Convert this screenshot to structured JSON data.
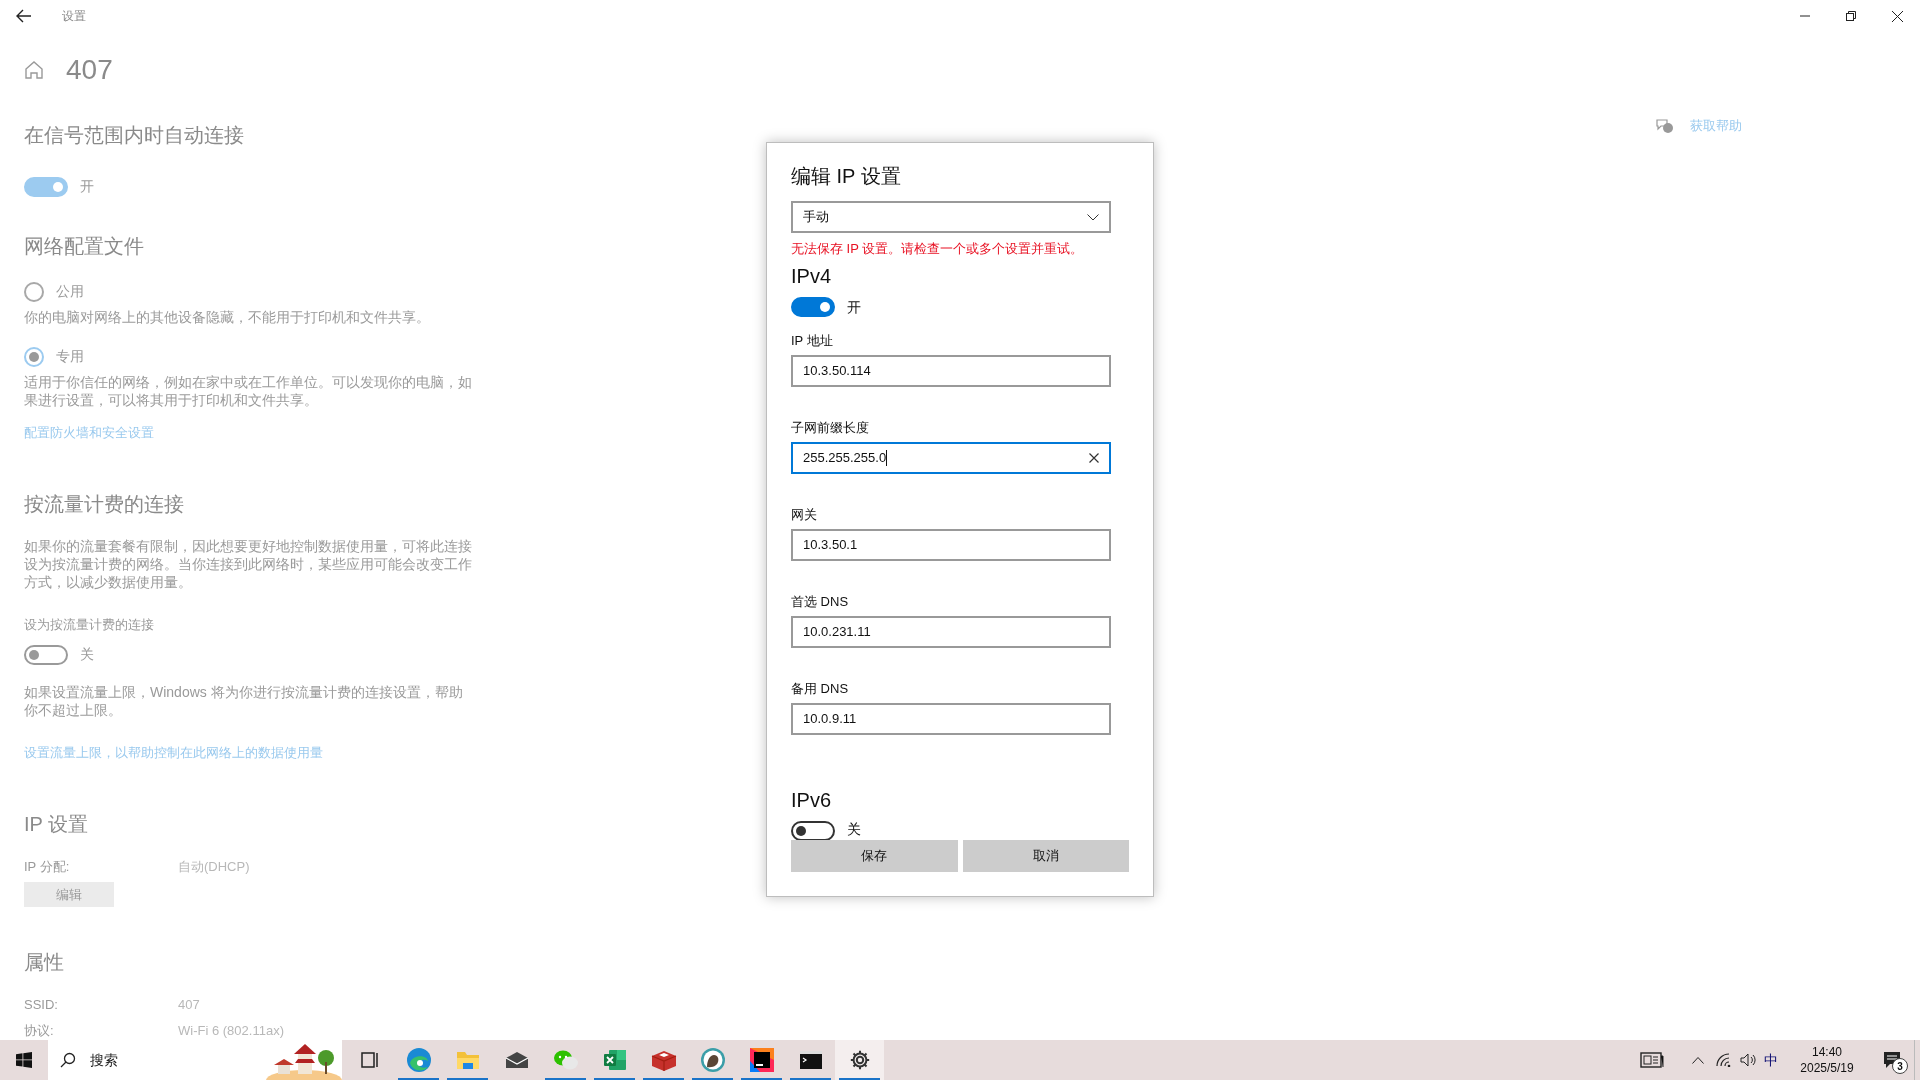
{
  "window": {
    "title": "设置"
  },
  "page": {
    "title": "407"
  },
  "auto_connect": {
    "heading": "在信号范围内时自动连接",
    "toggle": {
      "on": true,
      "label": "开"
    }
  },
  "profile": {
    "heading": "网络配置文件",
    "options": [
      {
        "label": "公用",
        "selected": false,
        "description": "你的电脑对网络上的其他设备隐藏，不能用于打印机和文件共享。"
      },
      {
        "label": "专用",
        "selected": true,
        "description": "适用于你信任的网络，例如在家中或在工作单位。可以发现你的电脑，如果进行设置，可以将其用于打印机和文件共享。"
      }
    ],
    "link": "配置防火墙和安全设置"
  },
  "metered": {
    "heading": "按流量计费的连接",
    "description": "如果你的流量套餐有限制，因此想要更好地控制数据使用量，可将此连接设为按流量计费的网络。当你连接到此网络时，某些应用可能会改变工作方式，以减少数据使用量。",
    "toggle_label": "设为按流量计费的连接",
    "toggle": {
      "on": false,
      "label": "关"
    },
    "note": "如果设置流量上限，Windows 将为你进行按流量计费的连接设置，帮助你不超过上限。",
    "link": "设置流量上限，以帮助控制在此网络上的数据使用量"
  },
  "ip_settings": {
    "heading": "IP 设置",
    "label": "IP 分配:",
    "value": "自动(DHCP)",
    "button": "编辑"
  },
  "properties": {
    "heading": "属性",
    "rows": [
      {
        "label": "SSID:",
        "value": "407"
      },
      {
        "label": "协议:",
        "value": "Wi-Fi 6 (802.11ax)"
      }
    ]
  },
  "help": {
    "link": "获取帮助"
  },
  "dialog": {
    "title": "编辑 IP 设置",
    "mode": "手动",
    "error": "无法保存 IP 设置。请检查一个或多个设置并重试。",
    "ipv4": {
      "heading": "IPv4",
      "toggle": {
        "on": true,
        "label": "开"
      },
      "fields": [
        {
          "label": "IP 地址",
          "value": "10.3.50.114",
          "focused": false
        },
        {
          "label": "子网前缀长度",
          "value": "255.255.255.0",
          "focused": true
        },
        {
          "label": "网关",
          "value": "10.3.50.1",
          "focused": false
        },
        {
          "label": "首选 DNS",
          "value": "10.0.231.11",
          "focused": false
        },
        {
          "label": "备用 DNS",
          "value": "10.0.9.11",
          "focused": false
        }
      ]
    },
    "ipv6": {
      "heading": "IPv6",
      "toggle": {
        "on": false,
        "label": "关"
      }
    },
    "buttons": [
      "保存",
      "取消"
    ]
  },
  "taskbar": {
    "search_placeholder": "搜索",
    "apps": [
      {
        "kind": "taskview",
        "running": false,
        "active": false
      },
      {
        "kind": "edge",
        "running": true,
        "active": false
      },
      {
        "kind": "explorer",
        "running": true,
        "active": false
      },
      {
        "kind": "mail",
        "running": false,
        "active": false
      },
      {
        "kind": "wechat",
        "running": true,
        "active": false
      },
      {
        "kind": "excel",
        "running": true,
        "active": false
      },
      {
        "kind": "redis",
        "running": true,
        "active": false
      },
      {
        "kind": "dbeaver",
        "running": true,
        "active": false
      },
      {
        "kind": "jetbrains",
        "running": true,
        "active": false
      },
      {
        "kind": "terminal",
        "running": true,
        "active": false
      },
      {
        "kind": "settings",
        "running": true,
        "active": true
      }
    ],
    "ime": "中",
    "time": "14:40",
    "date": "2025/5/19",
    "notifications": "3"
  }
}
